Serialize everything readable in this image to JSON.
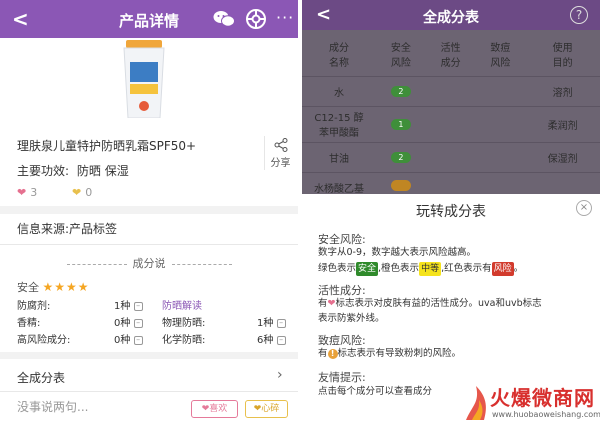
{
  "left": {
    "topbar": {
      "back": "<",
      "title": "产品详情",
      "more": "···"
    },
    "product": {
      "name": "理肤泉儿童特护防晒乳霜SPF50+",
      "effect_label": "主要功效:",
      "effects": "防晒 保湿",
      "share_label": "分享",
      "likes": "3",
      "unlikes": "0"
    },
    "source": "信息来源:产品标签",
    "analysis": {
      "heading": "成分说",
      "safety_label": "安全",
      "stars": "★★★★",
      "rows": [
        {
          "label": "防腐剂:",
          "value": "1种",
          "right_label": "防晒解读",
          "right_value": ""
        },
        {
          "label": "香精:",
          "value": "0种",
          "right_label": "物理防晒:",
          "right_value": "1种"
        },
        {
          "label": "高风险成分:",
          "value": "0种",
          "right_label": "化学防晒:",
          "right_value": "6种"
        }
      ]
    },
    "full_list": "全成分表",
    "comment_placeholder": "没事说两句...",
    "like_button": "喜欢",
    "heart_button": "心碎"
  },
  "right": {
    "topbar": {
      "back": "<",
      "title": "全成分表",
      "help": "?"
    },
    "columns": [
      "成分\n名称",
      "安全\n风险",
      "活性\n成分",
      "致痘\n风险",
      "使用\n目的"
    ],
    "rows": [
      {
        "name": "水",
        "safety": "2",
        "purpose": "溶剂"
      },
      {
        "name": "C12-15 醇\n苯甲酸酯",
        "safety": "1",
        "purpose": "柔润剂"
      },
      {
        "name": "甘油",
        "safety": "2",
        "purpose": "保湿剂"
      },
      {
        "name": "水杨酸乙基",
        "safety": "",
        "purpose": ""
      }
    ],
    "modal": {
      "title": "玩转成分表",
      "close": "×",
      "safety_heading": "安全风险:",
      "safety_line1": "数字从0-9，数字越大表示风险越高。",
      "safety_line2_a": "绿色表示",
      "safety_tag_green": "安全",
      "safety_line2_b": ",橙色表示",
      "safety_tag_yellow": "中等",
      "safety_line2_c": ",红色表示有",
      "safety_tag_red": "风险",
      "safety_line2_d": "。",
      "active_heading": "活性成分:",
      "active_line_a": "有",
      "active_line_b": "标志表示对皮肤有益的活性成分。uva和uvb标志",
      "active_line2": "表示防紫外线。",
      "acne_heading": "致痘风险:",
      "acne_line_a": "有",
      "acne_line_b": "标志表示有导致粉刺的风险。",
      "tip_heading": "友情提示:",
      "tip_line": "点击每个成分可以查看成分"
    }
  },
  "watermark": {
    "brand": "火爆微商网",
    "url": "www.huobaoweishang.com"
  },
  "colors": {
    "purple": "#8b57b5",
    "dark_purple": "#6c4a85",
    "green": "#2f8a2b",
    "orange": "#c08623",
    "red": "#d23b2d"
  }
}
